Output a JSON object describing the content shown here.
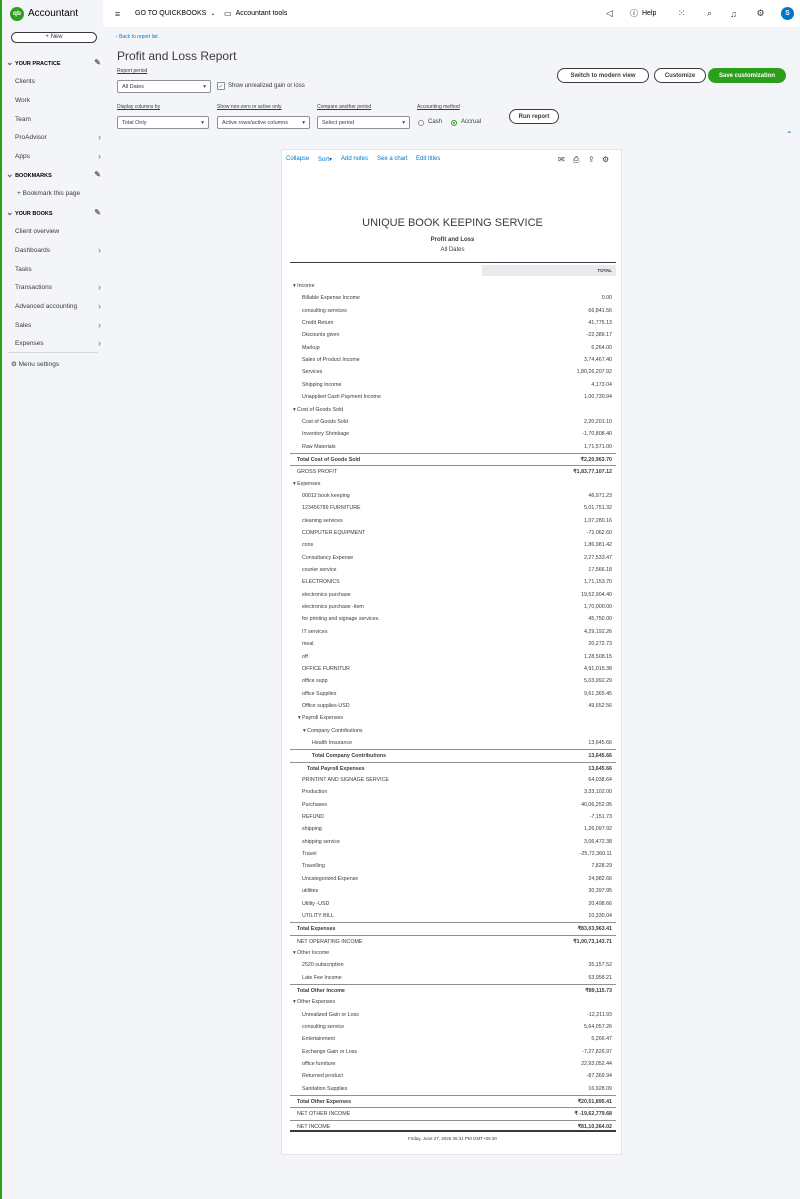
{
  "app": {
    "brand": "Accountant",
    "logo_letters": "qb"
  },
  "sidebar": {
    "new_label": "+ New",
    "your_practice": "YOUR PRACTICE",
    "practice_items": [
      "Clients",
      "Work",
      "Team",
      "ProAdvisor",
      "Apps"
    ],
    "bookmarks": "BOOKMARKS",
    "bookmark_this_page": "Bookmark this page",
    "your_books": "YOUR BOOKS",
    "books_items": [
      "Client overview",
      "Dashboards",
      "Tasks",
      "Transactions",
      "Advanced accounting",
      "Sales",
      "Expenses"
    ],
    "menu_settings": "Menu settings"
  },
  "topbar": {
    "go_to_quickbooks": "GO TO QUICKBOOKS",
    "accountant_tools": "Accountant tools",
    "help": "Help",
    "avatar_initial": "S"
  },
  "header": {
    "back_link": "Back to report list",
    "title": "Profit and Loss Report",
    "report_period_label": "Report period",
    "report_period_value": "All Dates",
    "unrealized_label": "Show unrealized gain or loss",
    "switch_modern": "Switch to modern view",
    "customize": "Customize",
    "save_customization": "Save customization",
    "display_columns_label": "Display columns by",
    "display_columns_value": "Total Only",
    "non_zero_label": "Show non-zero or active only",
    "non_zero_value": "Active rows/active columns",
    "compare_label": "Compare another period",
    "compare_value": "Select period",
    "accounting_method_label": "Accounting method",
    "cash_label": "Cash",
    "accrual_label": "Accrual",
    "run_report": "Run report"
  },
  "report_toolbar": {
    "collapse": "Collapse",
    "sort": "Sort",
    "add_notes": "Add notes",
    "see_chart": "See a chart",
    "edit_titles": "Edit titles"
  },
  "report": {
    "company": "UNIQUE BOOK KEEPING SERVICE",
    "title": "Profit and Loss",
    "period": "All Dates",
    "column_header": "TOTAL",
    "timestamp": "Friday, June 27, 2025  05:31 PM GMT+05:30",
    "rows": [
      {
        "label": "Income",
        "amount": "",
        "type": "sec",
        "indent": 0
      },
      {
        "label": "Billable Expense Income",
        "amount": "0.00",
        "type": "item",
        "indent": 1
      },
      {
        "label": "consulting services",
        "amount": "66,841.56",
        "type": "item",
        "indent": 1
      },
      {
        "label": "Credit Return",
        "amount": "41,775.13",
        "type": "item",
        "indent": 1
      },
      {
        "label": "Discounts given",
        "amount": "-22,389.17",
        "type": "item",
        "indent": 1
      },
      {
        "label": "Markup",
        "amount": "6,264.00",
        "type": "item",
        "indent": 1
      },
      {
        "label": "Sales of Product Income",
        "amount": "3,74,467.40",
        "type": "item",
        "indent": 1
      },
      {
        "label": "Services",
        "amount": "1,80,26,207.92",
        "type": "item",
        "indent": 1
      },
      {
        "label": "Shipping Income",
        "amount": "4,173.04",
        "type": "item",
        "indent": 1
      },
      {
        "label": "Unapplied Cash Payment Income",
        "amount": "1,00,730.94",
        "type": "item",
        "indent": 1
      },
      {
        "label": "Cost of Goods Sold",
        "amount": "",
        "type": "sec",
        "indent": 0
      },
      {
        "label": "Cost of Goods Sold",
        "amount": "2,20,201.10",
        "type": "item",
        "indent": 1
      },
      {
        "label": "Inventory Shrinkage",
        "amount": "-1,70,808.40",
        "type": "item",
        "indent": 1
      },
      {
        "label": "Raw Materials",
        "amount": "1,71,571.00",
        "type": "item",
        "indent": 1
      },
      {
        "label": "Total Cost of Goods Sold",
        "amount": "₹2,20,963.70",
        "type": "total",
        "indent": 0
      },
      {
        "label": "GROSS PROFIT",
        "amount": "₹1,83,77,107.12",
        "type": "net",
        "indent": 0
      },
      {
        "label": "Expenses",
        "amount": "",
        "type": "sec",
        "indent": 0
      },
      {
        "label": "00012 book keeping",
        "amount": "46,971.23",
        "type": "item",
        "indent": 1
      },
      {
        "label": "123456789 FURNITURE",
        "amount": "5,01,751.32",
        "type": "item",
        "indent": 1
      },
      {
        "label": "cleaning services",
        "amount": "1,07,280.16",
        "type": "item",
        "indent": 1
      },
      {
        "label": "COMPUTER EQUIPMENT",
        "amount": "-72,062.60",
        "type": "item",
        "indent": 1
      },
      {
        "label": "cons",
        "amount": "1,86,981.42",
        "type": "item",
        "indent": 1
      },
      {
        "label": "Consultancy Expense",
        "amount": "2,27,533.47",
        "type": "item",
        "indent": 1
      },
      {
        "label": "courier service",
        "amount": "17,566.18",
        "type": "item",
        "indent": 1
      },
      {
        "label": "ELECTRONICS",
        "amount": "1,71,153.70",
        "type": "item",
        "indent": 1
      },
      {
        "label": "electronics purchase",
        "amount": "19,52,904.40",
        "type": "item",
        "indent": 1
      },
      {
        "label": "electronics purchase -item",
        "amount": "1,70,000.00",
        "type": "item",
        "indent": 1
      },
      {
        "label": "for printing and signage services.",
        "amount": "45,750.00",
        "type": "item",
        "indent": 1
      },
      {
        "label": "IT services",
        "amount": "4,29,192.26",
        "type": "item",
        "indent": 1
      },
      {
        "label": "meal",
        "amount": "20,272.73",
        "type": "item",
        "indent": 1
      },
      {
        "label": "off",
        "amount": "1,28,508.15",
        "type": "item",
        "indent": 1
      },
      {
        "label": "OFFICE FURNITUR",
        "amount": "4,91,015.38",
        "type": "item",
        "indent": 1
      },
      {
        "label": "office supp",
        "amount": "5,03,992.29",
        "type": "item",
        "indent": 1
      },
      {
        "label": "office Supplies",
        "amount": "9,61,365.45",
        "type": "item",
        "indent": 1
      },
      {
        "label": "Office supplies-USD",
        "amount": "49,652.56",
        "type": "item",
        "indent": 1
      },
      {
        "label": "Payroll Expenses",
        "amount": "",
        "type": "sec",
        "indent": 1
      },
      {
        "label": "Company Contributions",
        "amount": "",
        "type": "sec",
        "indent": 2
      },
      {
        "label": "Health Insurance",
        "amount": "13,645.66",
        "type": "item",
        "indent": 3
      },
      {
        "label": "Total Company Contributions",
        "amount": "13,645.66",
        "type": "total",
        "indent": 3
      },
      {
        "label": "Total Payroll Expenses",
        "amount": "13,645.66",
        "type": "total",
        "indent": 2
      },
      {
        "label": "PRINTINT AND SIGNAGE SERVICE",
        "amount": "64,038.64",
        "type": "item",
        "indent": 1
      },
      {
        "label": "Production",
        "amount": "3,33,102.00",
        "type": "item",
        "indent": 1
      },
      {
        "label": "Purchases",
        "amount": "40,06,252.95",
        "type": "item",
        "indent": 1
      },
      {
        "label": "REFUND",
        "amount": "-7,151.73",
        "type": "item",
        "indent": 1
      },
      {
        "label": "shipping",
        "amount": "1,26,097.92",
        "type": "item",
        "indent": 1
      },
      {
        "label": "shipping service",
        "amount": "3,06,472.38",
        "type": "item",
        "indent": 1
      },
      {
        "label": "Travel",
        "amount": "-25,72,360.11",
        "type": "item",
        "indent": 1
      },
      {
        "label": "Travelling",
        "amount": "7,828.29",
        "type": "item",
        "indent": 1
      },
      {
        "label": "Uncategorized Expense",
        "amount": "24,982.66",
        "type": "item",
        "indent": 1
      },
      {
        "label": "utilities",
        "amount": "30,397.95",
        "type": "item",
        "indent": 1
      },
      {
        "label": "Utility -USD",
        "amount": "20,498.66",
        "type": "item",
        "indent": 1
      },
      {
        "label": "UTILITY BILL",
        "amount": "10,330.04",
        "type": "item",
        "indent": 1
      },
      {
        "label": "Total Expenses",
        "amount": "₹83,03,963.41",
        "type": "total",
        "indent": 0
      },
      {
        "label": "NET OPERATING INCOME",
        "amount": "₹1,00,73,143.71",
        "type": "net",
        "indent": 0
      },
      {
        "label": "Other Income",
        "amount": "",
        "type": "sec",
        "indent": 0
      },
      {
        "label": "2520 subscription",
        "amount": "35,157.52",
        "type": "item",
        "indent": 1
      },
      {
        "label": "Late Fee Income",
        "amount": "53,958.21",
        "type": "item",
        "indent": 1
      },
      {
        "label": "Total Other Income",
        "amount": "₹89,115.73",
        "type": "total",
        "indent": 0
      },
      {
        "label": "Other Expenses",
        "amount": "",
        "type": "sec",
        "indent": 0
      },
      {
        "label": "Unrealized Gain or Loss",
        "amount": "-12,211.93",
        "type": "item",
        "indent": 1
      },
      {
        "label": "consulting service",
        "amount": "5,64,057.26",
        "type": "item",
        "indent": 1
      },
      {
        "label": "Entertainment",
        "amount": "5,266.47",
        "type": "item",
        "indent": 1
      },
      {
        "label": "Exchange Gain or Loss",
        "amount": "-7,27,826.97",
        "type": "item",
        "indent": 1
      },
      {
        "label": "office furniture",
        "amount": "22,93,052.44",
        "type": "item",
        "indent": 1
      },
      {
        "label": "Returned product",
        "amount": "-87,369.94",
        "type": "item",
        "indent": 1
      },
      {
        "label": "Sanitation Supplies",
        "amount": "16,928.09",
        "type": "item",
        "indent": 1
      },
      {
        "label": "Total Other Expenses",
        "amount": "₹20,51,895.41",
        "type": "total",
        "indent": 0
      },
      {
        "label": "NET OTHER INCOME",
        "amount": "₹ -19,62,779.68",
        "type": "net",
        "indent": 0
      },
      {
        "label": "NET INCOME",
        "amount": "₹81,10,364.02",
        "type": "net final",
        "indent": 0
      }
    ]
  },
  "colors": {
    "brand_green": "#2ca01c",
    "link_blue": "#0077c5",
    "text": "#393a3d"
  }
}
